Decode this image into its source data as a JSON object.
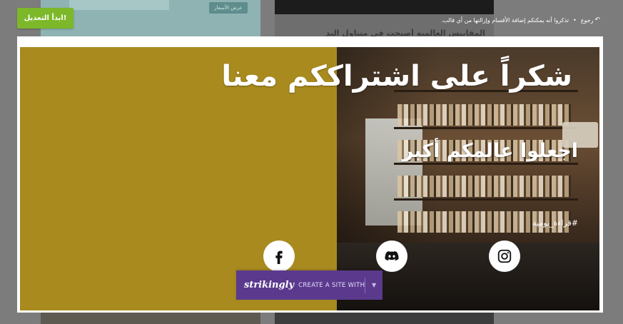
{
  "toolbar": {
    "start_edit_label": "ابدأ التعديل!",
    "back_label": "رجوع",
    "info_text": "تذكروا أنه يمكنكم إضافة الأقسام وإزالتها من أي قالب."
  },
  "background": {
    "price_button_label": "عرض الأسعار",
    "article_title": "المقاييس العالمية أصبحت في متناول اليد"
  },
  "preview": {
    "headline": "شكراً على اشتراككم معنا",
    "subhead": "اجعلوا عالمكم أكبر",
    "hashtag": "#قراءة_يومية",
    "left_panel_color": "#a88a1f",
    "social_links": [
      {
        "name": "facebook",
        "icon": "facebook-icon"
      },
      {
        "name": "discord",
        "icon": "discord-icon"
      },
      {
        "name": "instagram",
        "icon": "instagram-icon"
      }
    ]
  },
  "strikingly": {
    "brand": "strikingly",
    "create_label": "CREATE A SITE WITH",
    "accent": "#5b3a8e"
  },
  "colors": {
    "start_button": "#7cb829",
    "overlay": "#7c7c7c"
  }
}
